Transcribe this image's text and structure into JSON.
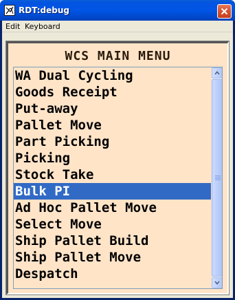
{
  "window": {
    "title": "RDT:debug",
    "icons": {
      "app": "app-window-icon",
      "close": "close-icon"
    }
  },
  "menubar": {
    "items": [
      {
        "label": "Edit"
      },
      {
        "label": "Keyboard"
      }
    ]
  },
  "terminal": {
    "title": "WCS MAIN MENU",
    "background_color": "#ffe4c8",
    "selection_color": "#316ac5",
    "selected_index": 7,
    "items": [
      {
        "label": "WA Dual Cycling"
      },
      {
        "label": "Goods Receipt"
      },
      {
        "label": "Put-away"
      },
      {
        "label": "Pallet Move"
      },
      {
        "label": "Part Picking"
      },
      {
        "label": "Picking"
      },
      {
        "label": "Stock Take"
      },
      {
        "label": "Bulk PI"
      },
      {
        "label": "Ad Hoc Pallet Move"
      },
      {
        "label": "Select Move"
      },
      {
        "label": "Ship Pallet Build"
      },
      {
        "label": "Ship Pallet Move"
      },
      {
        "label": "Despatch"
      }
    ]
  },
  "scrollbar": {
    "icons": {
      "up": "scroll-up-arrow-icon",
      "down": "scroll-down-arrow-icon"
    }
  }
}
